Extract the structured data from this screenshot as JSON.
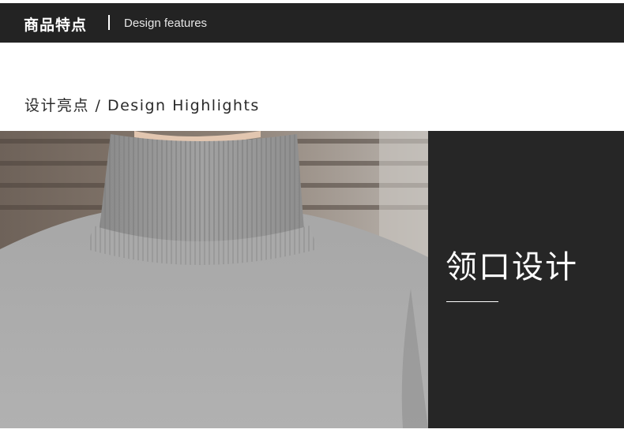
{
  "header": {
    "title_cn": "商品特点",
    "title_en": "Design features"
  },
  "section": {
    "subtitle": "设计亮点 / Design Highlights"
  },
  "feature_panel": {
    "title": "领口设计"
  },
  "colors": {
    "header_bg": "#232323",
    "panel_bg": "#262626",
    "sweater": "#9c9c9c"
  }
}
